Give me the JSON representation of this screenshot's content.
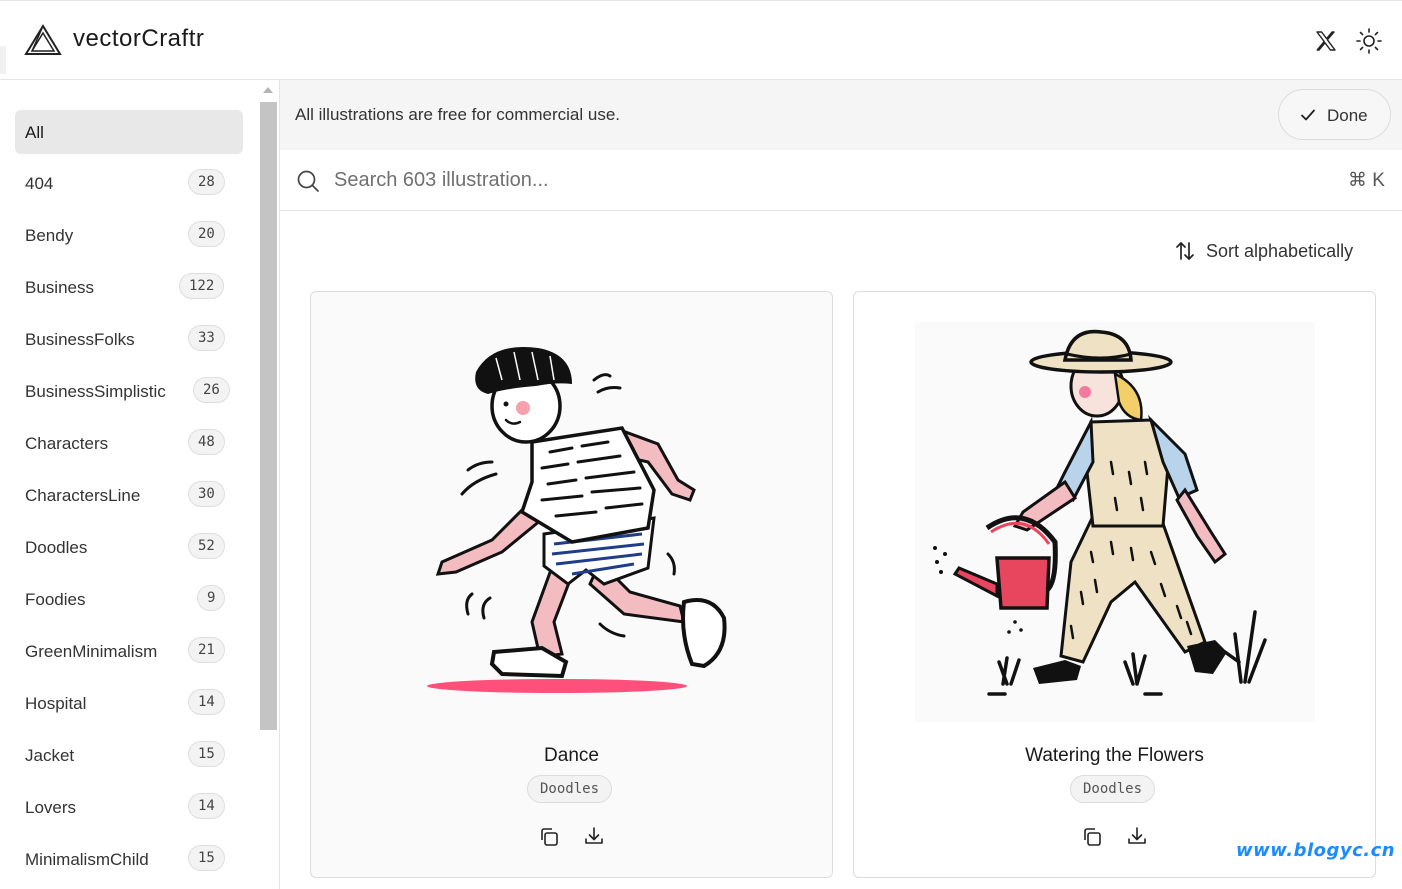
{
  "app": {
    "name": "vectorCraftr",
    "logo_icon": "triangle-logo-icon"
  },
  "header": {
    "social_icon": "x-icon",
    "theme_icon": "sun-icon"
  },
  "sidebar": {
    "items": [
      {
        "label": "All",
        "count": null,
        "active": true
      },
      {
        "label": "404",
        "count": "28"
      },
      {
        "label": "Bendy",
        "count": "20"
      },
      {
        "label": "Business",
        "count": "122"
      },
      {
        "label": "BusinessFolks",
        "count": "33"
      },
      {
        "label": "BusinessSimplistic",
        "count": "26"
      },
      {
        "label": "Characters",
        "count": "48"
      },
      {
        "label": "CharactersLine",
        "count": "30"
      },
      {
        "label": "Doodles",
        "count": "52"
      },
      {
        "label": "Foodies",
        "count": "9"
      },
      {
        "label": "GreenMinimalism",
        "count": "21"
      },
      {
        "label": "Hospital",
        "count": "14"
      },
      {
        "label": "Jacket",
        "count": "15"
      },
      {
        "label": "Lovers",
        "count": "14"
      },
      {
        "label": "MinimalismChild",
        "count": "15"
      }
    ]
  },
  "notice": {
    "text": "All illustrations are free for commercial use.",
    "done_label": "Done"
  },
  "search": {
    "placeholder": "Search 603 illustration...",
    "shortcut": "⌘ K"
  },
  "sort": {
    "label": "Sort alphabetically"
  },
  "cards": [
    {
      "title": "Dance",
      "tag": "Doodles"
    },
    {
      "title": "Watering the Flowers",
      "tag": "Doodles"
    }
  ],
  "watermark": "www.blogyc.cn",
  "colors": {
    "accent_pink": "#ff4f7b",
    "card_bg": "#fafafa",
    "watermark": "#1a8cff"
  }
}
